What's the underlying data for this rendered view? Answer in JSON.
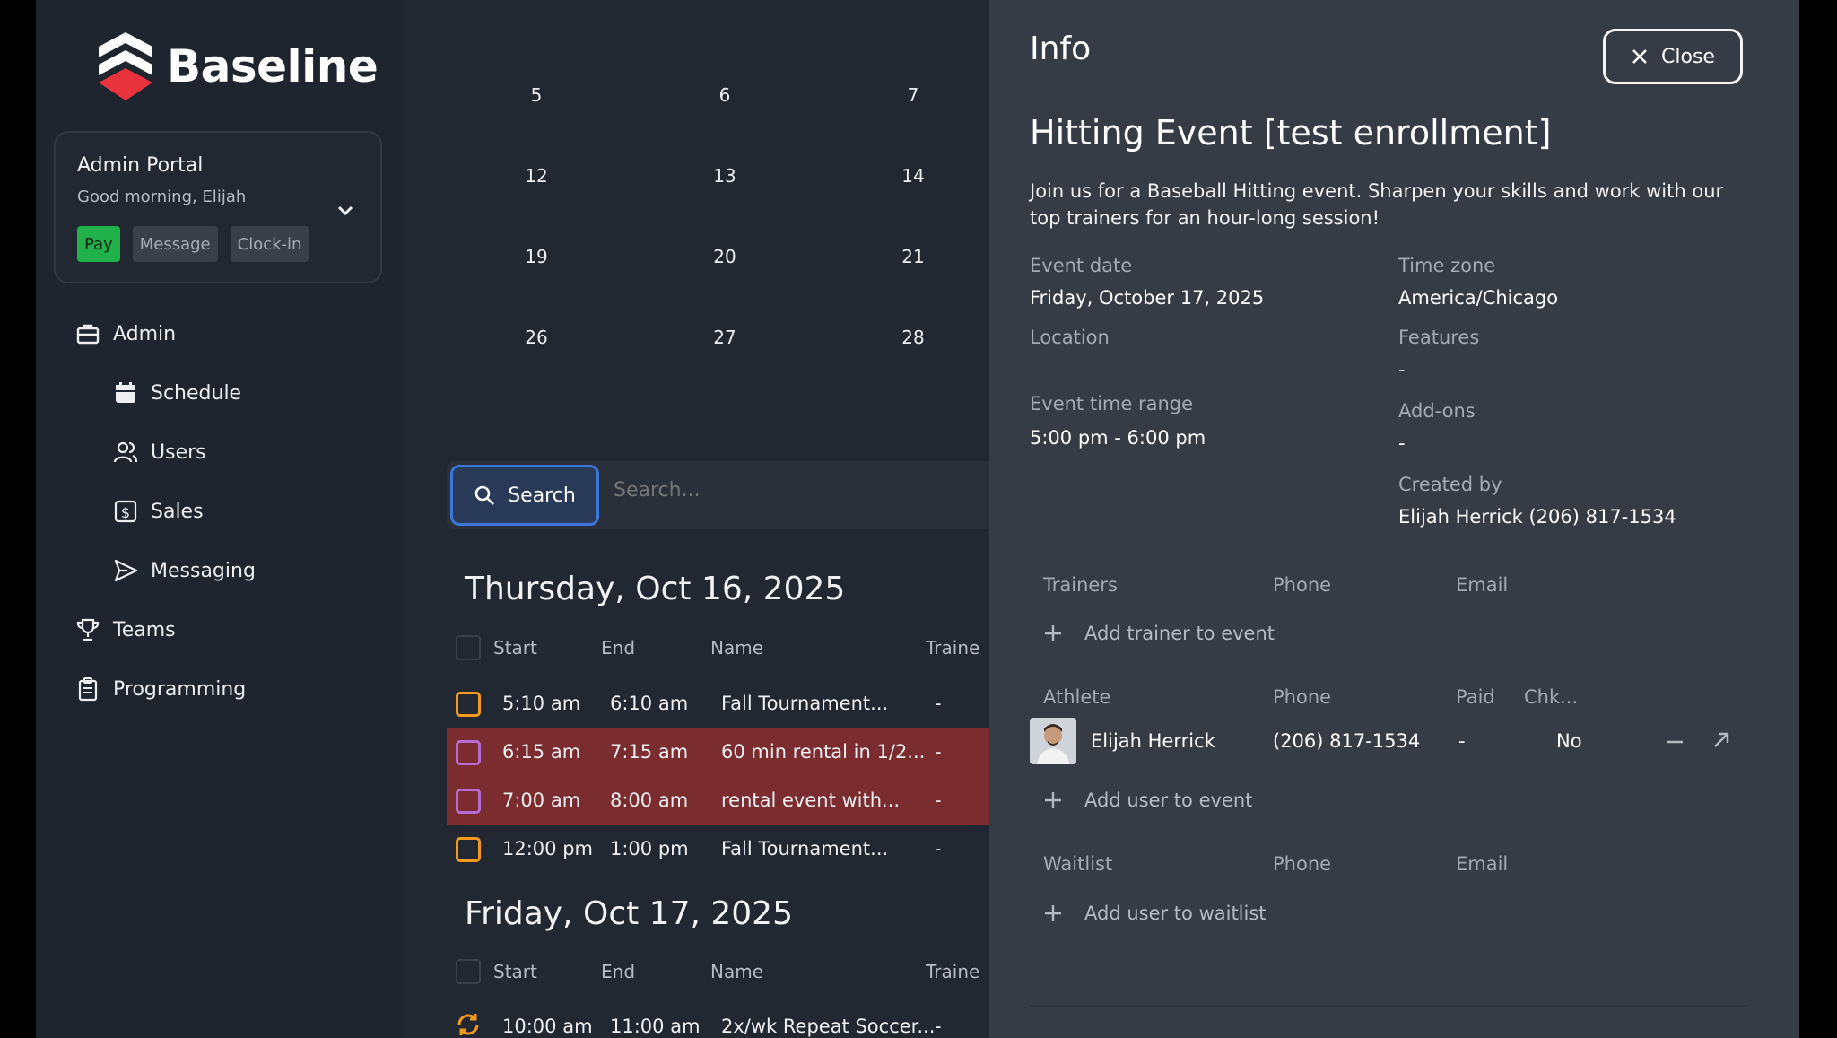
{
  "app": {
    "name": "Baseline"
  },
  "portal": {
    "title": "Admin Portal",
    "greeting": "Good morning, Elijah",
    "buttons": {
      "pay": "Pay",
      "message": "Message",
      "clockin": "Clock-in"
    }
  },
  "nav": {
    "admin": "Admin",
    "schedule": "Schedule",
    "users": "Users",
    "sales": "Sales",
    "messaging": "Messaging",
    "teams": "Teams",
    "programming": "Programming"
  },
  "calendar": {
    "rows": [
      [
        "5",
        "6",
        "7"
      ],
      [
        "12",
        "13",
        "14"
      ],
      [
        "19",
        "20",
        "21"
      ],
      [
        "26",
        "27",
        "28"
      ]
    ]
  },
  "search": {
    "button": "Search",
    "placeholder": "Search..."
  },
  "columns": {
    "start": "Start",
    "end": "End",
    "name": "Name",
    "trainer": "Traine"
  },
  "days": [
    {
      "title": "Thursday, Oct 16, 2025",
      "events": [
        {
          "start": "5:10 am",
          "end": "6:10 am",
          "name": "Fall Tournament...",
          "trainer": "-"
        },
        {
          "start": "6:15 am",
          "end": "7:15 am",
          "name": "60 min rental in 1/2...",
          "trainer": "-"
        },
        {
          "start": "7:00 am",
          "end": "8:00 am",
          "name": "rental event with...",
          "trainer": "-"
        },
        {
          "start": "12:00 pm",
          "end": "1:00 pm",
          "name": "Fall Tournament...",
          "trainer": "-"
        }
      ]
    },
    {
      "title": "Friday, Oct 17, 2025",
      "events": [
        {
          "start": "10:00 am",
          "end": "11:00 am",
          "name": "2x/wk Repeat Soccer...",
          "trainer": "-"
        }
      ]
    }
  ],
  "info": {
    "heading": "Info",
    "close": "Close",
    "event_title": "Hitting Event [test enrollment]",
    "description": "Join us for a Baseball Hitting event. Sharpen your skills and work with our top trainers for an hour-long session!",
    "event_date_label": "Event date",
    "event_date": "Friday, October 17, 2025",
    "time_zone_label": "Time zone",
    "time_zone": "America/Chicago",
    "location_label": "Location",
    "features_label": "Features",
    "features": "-",
    "time_range_label": "Event time range",
    "time_range": "5:00 pm - 6:00 pm",
    "addons_label": "Add-ons",
    "addons": "-",
    "created_by_label": "Created by",
    "created_by": "Elijah Herrick (206) 817-1534",
    "trainers": {
      "col1": "Trainers",
      "col2": "Phone",
      "col3": "Email",
      "add": "Add trainer to event"
    },
    "athletes": {
      "col1": "Athlete",
      "col2": "Phone",
      "col3": "Paid",
      "col4": "Chk...",
      "rows": [
        {
          "name": "Elijah Herrick",
          "phone": "(206) 817-1534",
          "paid": "-",
          "checked": "No"
        }
      ],
      "add": "Add user to event"
    },
    "waitlist": {
      "col1": "Waitlist",
      "col2": "Phone",
      "col3": "Email",
      "add": "Add user to waitlist"
    }
  },
  "colors": {
    "accent_blue": "#3a76d8",
    "event_red": "#7a2c2e",
    "pay_green": "#22b04a",
    "orange": "#f39a1c",
    "purple": "#b86bd6"
  }
}
